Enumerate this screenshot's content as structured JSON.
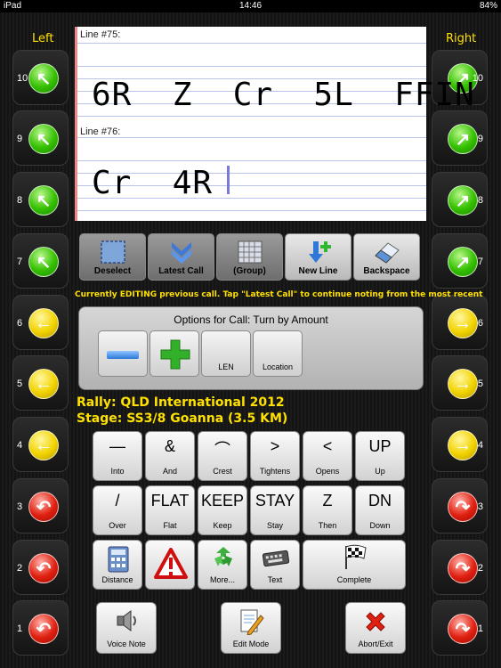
{
  "status_bar": {
    "device": "iPad",
    "time": "14:46",
    "battery": "84%"
  },
  "side_labels": {
    "left": "Left",
    "right": "Right"
  },
  "turn_buttons": {
    "left": [
      {
        "num": "10",
        "color": "#34c000",
        "icon": "arrow-up-left-icon",
        "glyph": "↖"
      },
      {
        "num": "9",
        "color": "#34c000",
        "icon": "arrow-up-left-icon",
        "glyph": "↖"
      },
      {
        "num": "8",
        "color": "#34c000",
        "icon": "arrow-up-left-icon",
        "glyph": "↖"
      },
      {
        "num": "7",
        "color": "#34c000",
        "icon": "arrow-up-left-icon",
        "glyph": "↖"
      },
      {
        "num": "6",
        "color": "#f2d300",
        "icon": "arrow-left-icon",
        "glyph": "←"
      },
      {
        "num": "5",
        "color": "#f2d300",
        "icon": "arrow-left-icon",
        "glyph": "←"
      },
      {
        "num": "4",
        "color": "#f2d300",
        "icon": "arrow-left-icon",
        "glyph": "←"
      },
      {
        "num": "3",
        "color": "#e02010",
        "icon": "arrow-turn-left-icon",
        "glyph": "↶"
      },
      {
        "num": "2",
        "color": "#e02010",
        "icon": "arrow-turn-left-icon",
        "glyph": "↶"
      },
      {
        "num": "1",
        "color": "#e02010",
        "icon": "arrow-turn-left-icon",
        "glyph": "↶"
      }
    ],
    "right": [
      {
        "num": "10",
        "color": "#34c000",
        "icon": "arrow-up-right-icon",
        "glyph": "↗"
      },
      {
        "num": "9",
        "color": "#34c000",
        "icon": "arrow-up-right-icon",
        "glyph": "↗"
      },
      {
        "num": "8",
        "color": "#34c000",
        "icon": "arrow-up-right-icon",
        "glyph": "↗"
      },
      {
        "num": "7",
        "color": "#34c000",
        "icon": "arrow-up-right-icon",
        "glyph": "↗"
      },
      {
        "num": "6",
        "color": "#f2d300",
        "icon": "arrow-right-icon",
        "glyph": "→"
      },
      {
        "num": "5",
        "color": "#f2d300",
        "icon": "arrow-right-icon",
        "glyph": "→"
      },
      {
        "num": "4",
        "color": "#f2d300",
        "icon": "arrow-right-icon",
        "glyph": "→"
      },
      {
        "num": "3",
        "color": "#e02010",
        "icon": "arrow-turn-right-icon",
        "glyph": "↷"
      },
      {
        "num": "2",
        "color": "#e02010",
        "icon": "arrow-turn-right-icon",
        "glyph": "↷"
      },
      {
        "num": "1",
        "color": "#e02010",
        "icon": "arrow-turn-right-icon",
        "glyph": "↷"
      }
    ]
  },
  "notepad": {
    "line1_label": "Line #75:",
    "line1_text": "6R  Z  Cr  5L  FFIN",
    "line2_label": "Line #76:",
    "line2_text": "Cr  4R"
  },
  "toolbar": {
    "deselect": "Deselect",
    "latest_call": "Latest Call",
    "group": "(Group)",
    "new_line": "New Line",
    "backspace": "Backspace"
  },
  "edit_note": "Currently EDITING previous call. Tap \"Latest Call\" to continue noting from the most recent",
  "options": {
    "title": "Options for Call: Turn by Amount",
    "len": "LEN",
    "location": "Location"
  },
  "rally": {
    "rally_line": "Rally: QLD International 2012",
    "stage_line": "Stage: SS3/8 Goanna (3.5 KM)"
  },
  "keypad": {
    "row1": [
      {
        "glyph": "—",
        "label": "Into"
      },
      {
        "glyph": "&",
        "label": "And"
      },
      {
        "glyph": "⌒",
        "label": "Crest"
      },
      {
        "glyph": ">",
        "label": "Tightens"
      },
      {
        "glyph": "<",
        "label": "Opens"
      },
      {
        "glyph": "UP",
        "label": "Up"
      }
    ],
    "row2": [
      {
        "glyph": "/",
        "label": "Over"
      },
      {
        "glyph": "FLAT",
        "label": "Flat"
      },
      {
        "glyph": "KEEP",
        "label": "Keep"
      },
      {
        "glyph": "STAY",
        "label": "Stay"
      },
      {
        "glyph": "Z",
        "label": "Then"
      },
      {
        "glyph": "DN",
        "label": "Down"
      }
    ],
    "row3": {
      "distance": "Distance",
      "more": "More...",
      "text": "Text",
      "complete": "Complete"
    }
  },
  "bottom": {
    "voice_note": "Voice Note",
    "edit_mode": "Edit Mode",
    "abort_exit": "Abort/Exit"
  },
  "colors": {
    "accent_yellow": "#ffe100",
    "green": "#34c000",
    "yellow": "#f2d300",
    "red": "#e02010"
  }
}
